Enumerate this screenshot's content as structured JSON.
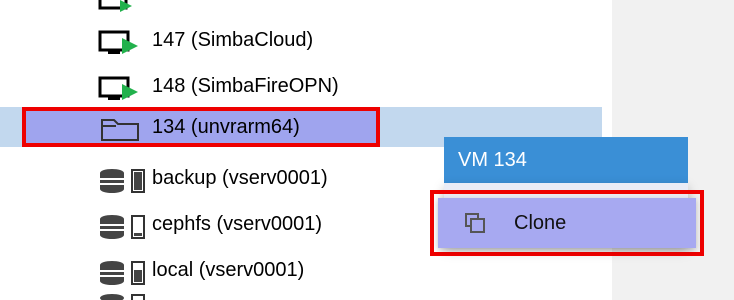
{
  "tree": {
    "items": [
      {
        "label": "147 (SimbaCloud)",
        "icon": "vm-running-icon"
      },
      {
        "label": "148 (SimbaFireOPN)",
        "icon": "vm-running-icon"
      },
      {
        "label": "134 (unvrarm64)",
        "icon": "template-icon"
      },
      {
        "label": "backup (vserv0001)",
        "icon": "storage-icon"
      },
      {
        "label": "cephfs (vserv0001)",
        "icon": "storage-icon"
      },
      {
        "label": "local (vserv0001)",
        "icon": "storage-icon"
      }
    ]
  },
  "context_menu": {
    "header": "VM 134",
    "items": [
      {
        "label": "Clone",
        "icon": "clone-icon"
      }
    ]
  },
  "colors": {
    "selection_row": "#c2d8ee",
    "selection_fill": "#9fa4ee",
    "highlight_border": "#ee0000",
    "menu_header": "#3a8fd6",
    "running_arrow": "#22b14c"
  }
}
